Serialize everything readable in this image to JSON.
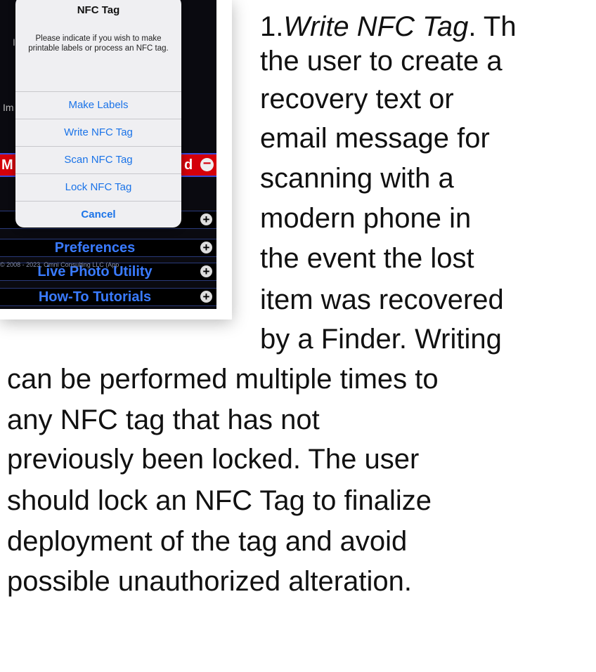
{
  "screenshot": {
    "background_items": {
      "side_letter_1": "I",
      "side_letter_2": "Im",
      "red_left_text": "M",
      "red_right_text": "d"
    },
    "menu": [
      {
        "label": "Preferences"
      },
      {
        "label": "Live Photo Utility"
      },
      {
        "label": "How-To Tutorials"
      }
    ],
    "copyright": "© 2008 - 2023, Omni Consulting LLC (App",
    "alert": {
      "title": "NFC Tag",
      "message": "Please indicate if you wish to make printable labels or process an NFC tag.",
      "buttons": [
        "Make Labels",
        "Write NFC Tag",
        "Scan NFC Tag",
        "Lock NFC Tag"
      ],
      "cancel": "Cancel"
    }
  },
  "text": {
    "number": "1.",
    "term": "Write NFC Tag",
    "lines_right": [
      ". Th",
      "the user to create a",
      "recovery text or",
      "email message for",
      "scanning with a",
      "modern phone in",
      "the event the lost",
      "item was recovered",
      "by a Finder. Writing"
    ],
    "lines_full": [
      "can be performed multiple times to",
      "any NFC tag that has not",
      "previously been locked. The user",
      "should lock an NFC Tag to finalize",
      "deployment of the tag and avoid",
      "possible unauthorized alteration."
    ]
  }
}
